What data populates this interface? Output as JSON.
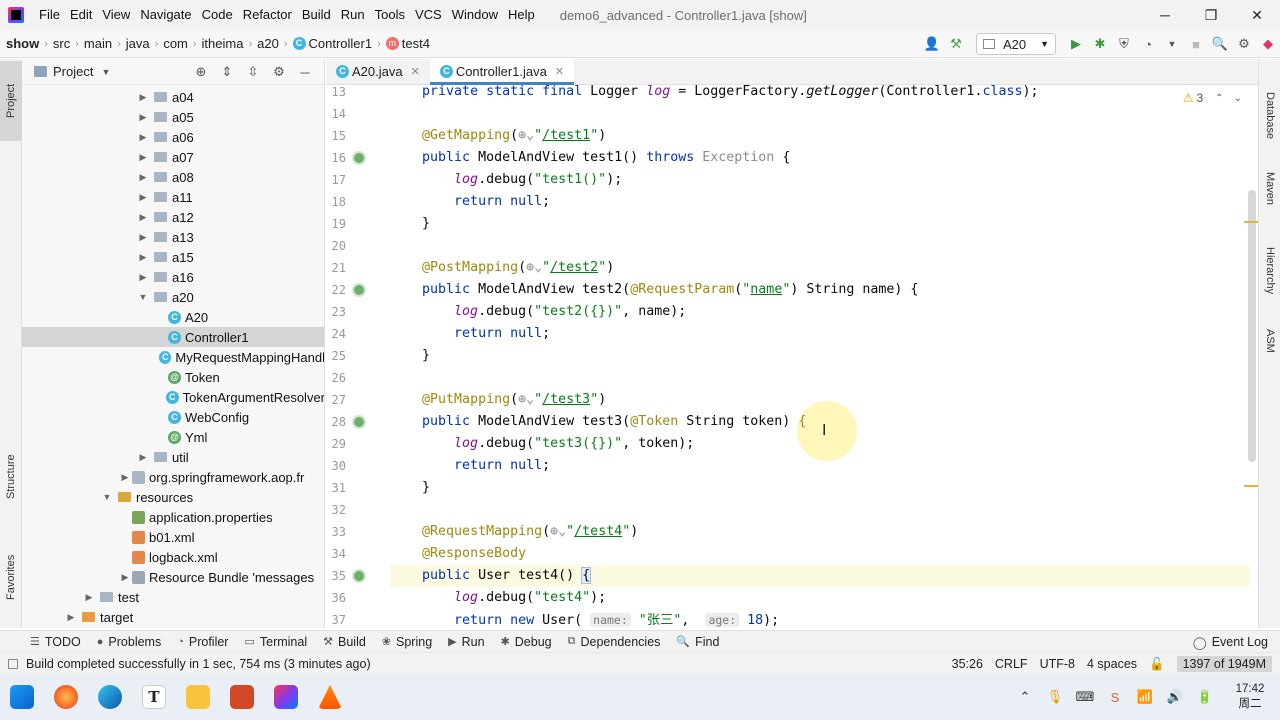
{
  "window": {
    "title": "demo6_advanced - Controller1.java [show]",
    "menu": [
      "File",
      "Edit",
      "View",
      "Navigate",
      "Code",
      "Refactor",
      "Build",
      "Run",
      "Tools",
      "VCS",
      "Window",
      "Help"
    ],
    "controls": [
      "─",
      "❐",
      "✕"
    ]
  },
  "navbar": {
    "breadcrumbs": [
      "show",
      "src",
      "main",
      "java",
      "com",
      "itheima",
      "a20",
      "Controller1",
      "test4"
    ],
    "run_config": "A20"
  },
  "left_strip": {
    "project": "Project",
    "structure": "Structure",
    "favorites": "Favorites"
  },
  "right_strip": {
    "database": "Database",
    "maven": "Maven",
    "hierarchy": "Hierarchy",
    "asm": "ASM"
  },
  "project_panel": {
    "title": "Project",
    "tree": [
      {
        "label": "a04",
        "type": "folder",
        "indent": 1,
        "arrow": "▶"
      },
      {
        "label": "a05",
        "type": "folder",
        "indent": 1,
        "arrow": "▶"
      },
      {
        "label": "a06",
        "type": "folder",
        "indent": 1,
        "arrow": "▶"
      },
      {
        "label": "a07",
        "type": "folder",
        "indent": 1,
        "arrow": "▶"
      },
      {
        "label": "a08",
        "type": "folder",
        "indent": 1,
        "arrow": "▶"
      },
      {
        "label": "a11",
        "type": "folder",
        "indent": 1,
        "arrow": "▶"
      },
      {
        "label": "a12",
        "type": "folder",
        "indent": 1,
        "arrow": "▶"
      },
      {
        "label": "a13",
        "type": "folder",
        "indent": 1,
        "arrow": "▶"
      },
      {
        "label": "a15",
        "type": "folder",
        "indent": 1,
        "arrow": "▶"
      },
      {
        "label": "a16",
        "type": "folder",
        "indent": 1,
        "arrow": "▶"
      },
      {
        "label": "a20",
        "type": "folder",
        "indent": 1,
        "arrow": "▼"
      },
      {
        "label": "A20",
        "type": "class",
        "indent": 2,
        "arrow": ""
      },
      {
        "label": "Controller1",
        "type": "class",
        "indent": 2,
        "arrow": "",
        "selected": true
      },
      {
        "label": "MyRequestMappingHandl",
        "type": "class",
        "indent": 2,
        "arrow": ""
      },
      {
        "label": "Token",
        "type": "annotation",
        "indent": 2,
        "arrow": ""
      },
      {
        "label": "TokenArgumentResolver",
        "type": "class",
        "indent": 2,
        "arrow": ""
      },
      {
        "label": "WebConfig",
        "type": "class",
        "indent": 2,
        "arrow": ""
      },
      {
        "label": "Yml",
        "type": "annotation",
        "indent": 2,
        "arrow": ""
      },
      {
        "label": "util",
        "type": "folder",
        "indent": 1,
        "arrow": "▶"
      },
      {
        "label": "org.springframework.aop.fr",
        "type": "pkg",
        "indent": 0,
        "arrow": "▶"
      },
      {
        "label": "resources",
        "type": "res",
        "indent": -1,
        "arrow": "▼"
      },
      {
        "label": "application.properties",
        "type": "prop",
        "indent": 0,
        "arrow": ""
      },
      {
        "label": "b01.xml",
        "type": "xml",
        "indent": 0,
        "arrow": ""
      },
      {
        "label": "logback.xml",
        "type": "xml",
        "indent": 0,
        "arrow": ""
      },
      {
        "label": "Resource Bundle 'messages",
        "type": "bundle",
        "indent": 0,
        "arrow": "▶"
      },
      {
        "label": "test",
        "type": "folder",
        "indent": -2,
        "arrow": "▶"
      },
      {
        "label": "target",
        "type": "tgt",
        "indent": -3,
        "arrow": "▶"
      }
    ]
  },
  "editor": {
    "tabs": [
      {
        "label": "A20.java",
        "active": false
      },
      {
        "label": "Controller1.java",
        "active": true
      }
    ],
    "warnings": "3",
    "lines": [
      {
        "n": "13",
        "html": "    <span class=\"kw\">private static final</span> Logger <span class=\"it\">log</span> = LoggerFactory.<span class=\"fn\">getLogger</span>(Controller1.<span class=\"kw\">class</span>);"
      },
      {
        "n": "14",
        "html": ""
      },
      {
        "n": "15",
        "html": "    <span class=\"an\">@GetMapping</span>(<span class=\"gr\">⊕⌄</span><span class=\"st\">\"<span class=\"ul\">/test1</span>\"</span>)"
      },
      {
        "n": "16",
        "html": "    <span class=\"kw\">public</span> ModelAndView test1() <span class=\"kw\">throws</span> <span class=\"gr\">Exception</span> {",
        "icon": true
      },
      {
        "n": "17",
        "html": "        <span class=\"it\">log</span>.debug(<span class=\"st\">\"test1()\"</span>);"
      },
      {
        "n": "18",
        "html": "        <span class=\"kw\">return null</span>;"
      },
      {
        "n": "19",
        "html": "    }"
      },
      {
        "n": "20",
        "html": ""
      },
      {
        "n": "21",
        "html": "    <span class=\"an\">@PostMapping</span>(<span class=\"gr\">⊕⌄</span><span class=\"st\">\"<span class=\"ul\">/test2</span>\"</span>)"
      },
      {
        "n": "22",
        "html": "    <span class=\"kw\">public</span> ModelAndView test2(<span class=\"an\">@RequestParam</span>(<span class=\"st\">\"<span class=\"ul\">name</span>\"</span>) String name) {",
        "icon": true
      },
      {
        "n": "23",
        "html": "        <span class=\"it\">log</span>.debug(<span class=\"st\">\"test2({})\"</span>, name);"
      },
      {
        "n": "24",
        "html": "        <span class=\"kw\">return null</span>;"
      },
      {
        "n": "25",
        "html": "    }"
      },
      {
        "n": "26",
        "html": ""
      },
      {
        "n": "27",
        "html": "    <span class=\"an\">@PutMapping</span>(<span class=\"gr\">⊕⌄</span><span class=\"st\">\"<span class=\"ul\">/test3</span>\"</span>)"
      },
      {
        "n": "28",
        "html": "    <span class=\"kw\">public</span> ModelAndView test3(<span class=\"an\">@Token</span> String token) {",
        "icon": true
      },
      {
        "n": "29",
        "html": "        <span class=\"it\">log</span>.debug(<span class=\"st\">\"test3({})\"</span>, token);"
      },
      {
        "n": "30",
        "html": "        <span class=\"kw\">return null</span>;"
      },
      {
        "n": "31",
        "html": "    }"
      },
      {
        "n": "32",
        "html": ""
      },
      {
        "n": "33",
        "html": "    <span class=\"an\">@RequestMapping</span>(<span class=\"gr\">⊕⌄</span><span class=\"st\">\"<span class=\"ul\">/test4</span>\"</span>)"
      },
      {
        "n": "34",
        "html": "    <span class=\"an\">@ResponseBody</span>"
      },
      {
        "n": "35",
        "html": "    <span class=\"kw\">public</span> User test4() <span class=\"brace\">{</span>",
        "icon": true,
        "current": true
      },
      {
        "n": "36",
        "html": "        <span class=\"it\">log</span>.debug(<span class=\"st\">\"test4\"</span>);"
      },
      {
        "n": "37",
        "html": "        <span class=\"kw\">return new</span> User( <span class=\"hint\">name:</span> <span class=\"st\">\"张三\"</span>,  <span class=\"hint\">age:</span> <span class=\"kw\">18</span>);"
      }
    ]
  },
  "bottom_tools": [
    "TODO",
    "Problems",
    "Profiler",
    "Terminal",
    "Build",
    "Spring",
    "Run",
    "Debug",
    "Dependencies",
    "Find"
  ],
  "bottom_tool_icons": [
    "☰",
    "●",
    "◔",
    "▭",
    "⚒",
    "❀",
    "▶",
    "✱",
    "⧉",
    "🔍"
  ],
  "event_log": "Event Log",
  "status": {
    "message": "Build completed successfully in 1 sec, 754 ms (3 minutes ago)",
    "position": "35:26",
    "line_sep": "CRLF",
    "encoding": "UTF-8",
    "indent": "4 spaces",
    "memory": "1397 of 1949M"
  },
  "taskbar": {
    "time": "17:42",
    "day": "周二"
  }
}
